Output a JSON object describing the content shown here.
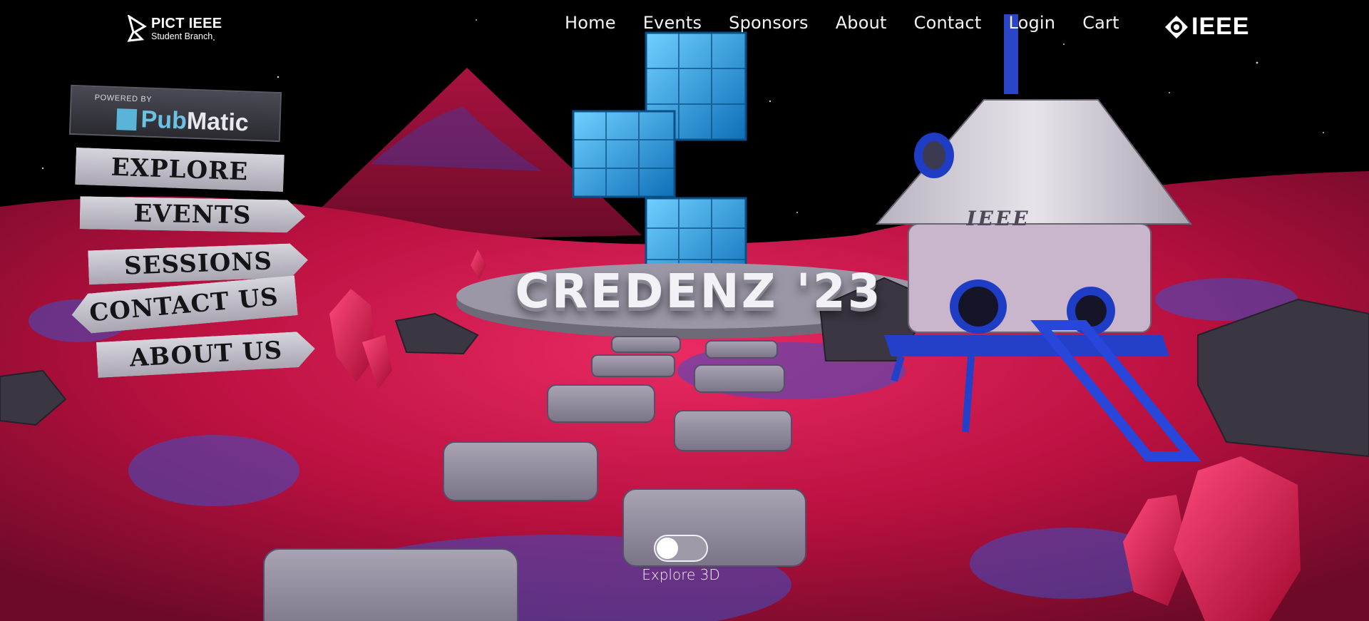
{
  "brand": {
    "title": "PICT IEEE",
    "subtitle": "Student Branch",
    "icon": "pict-ieee-logo"
  },
  "nav": [
    "Home",
    "Events",
    "Sponsors",
    "About",
    "Contact",
    "Login",
    "Cart"
  ],
  "partner_logo": {
    "text": "IEEE",
    "icon": "ieee-diamond-logo"
  },
  "hero": {
    "title": "CREDENZ '23"
  },
  "sponsor_board": {
    "note": "POWERED BY",
    "name_a": "Pub",
    "name_b": "Matic"
  },
  "signpost": {
    "explore": "EXPLORE",
    "events": "EVENTS",
    "sessions": "SESSIONS",
    "contact": "CONTACT US",
    "about": "ABOUT US"
  },
  "module_label": "IEEE",
  "toggle": {
    "label": "Explore 3D",
    "state": "off"
  },
  "colors": {
    "terrain": "#c3154a",
    "terrain_dark": "#6e0b2a",
    "cubes": "#2fa6e6",
    "sky": "#000000",
    "capsule": "#d9d5dd",
    "accent_blue": "#2340c8"
  }
}
